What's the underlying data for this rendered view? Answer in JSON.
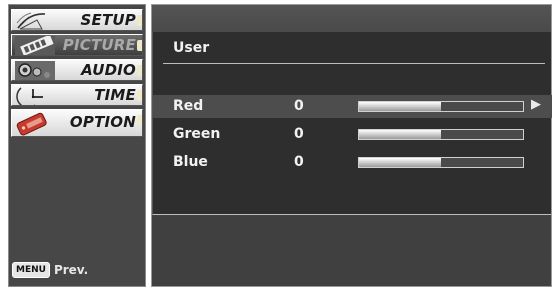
{
  "menu": {
    "items": [
      {
        "label": "SETUP",
        "icon": "satellite-dish-icon",
        "active": false
      },
      {
        "label": "PICTURE",
        "icon": "film-strip-icon",
        "active": true
      },
      {
        "label": "AUDIO",
        "icon": "speaker-icon",
        "active": false
      },
      {
        "label": "TIME",
        "icon": "clock-icon",
        "active": false
      },
      {
        "label": "OPTION",
        "icon": "option-tag-icon",
        "active": false
      }
    ],
    "footer": {
      "key_label": "MENU",
      "action_label": "Prev."
    }
  },
  "panel": {
    "title": "User",
    "rows": [
      {
        "label": "Red",
        "value": "0",
        "level": 0.5,
        "selected": true
      },
      {
        "label": "Green",
        "value": "0",
        "level": 0.5,
        "selected": false
      },
      {
        "label": "Blue",
        "value": "0",
        "level": 0.5,
        "selected": false
      }
    ]
  },
  "colors": {
    "active_menu_bg": "#474747",
    "menu_item_bg": "#e8e8e8",
    "panel_bg": "#2e2e2e",
    "selected_row_bg": "#4d4d4d",
    "text": "#f2f2f2"
  }
}
